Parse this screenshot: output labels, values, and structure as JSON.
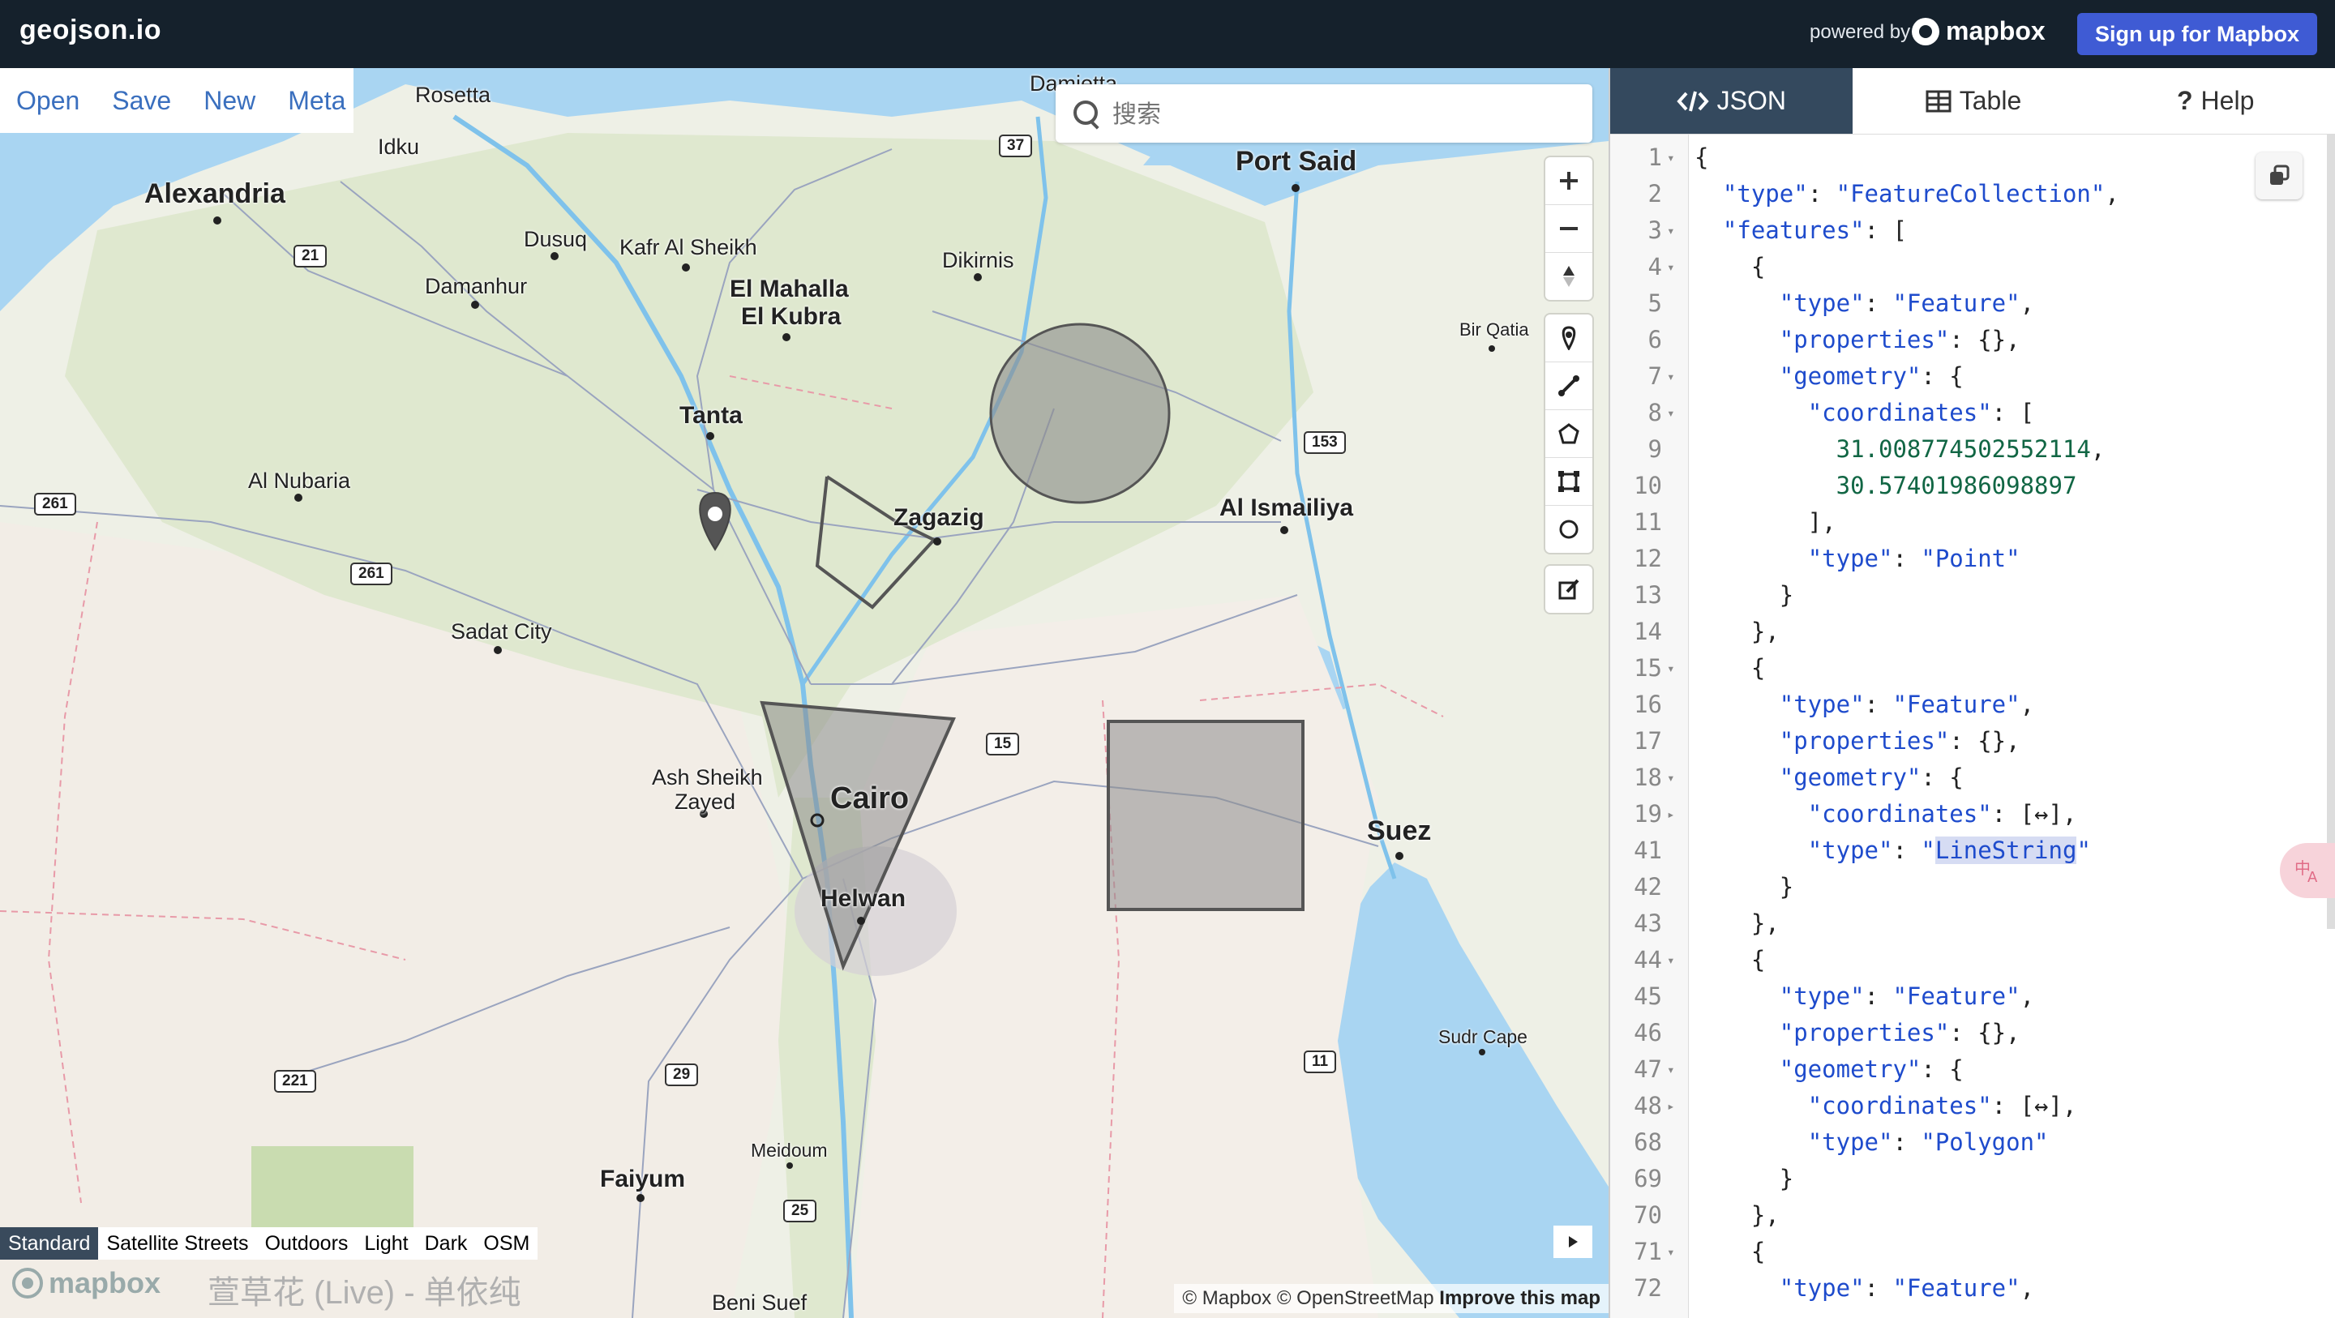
{
  "header": {
    "brand": "geojson.io",
    "powered_by": "powered by",
    "mapbox_logo": "mapbox",
    "signup_label": "Sign up for Mapbox"
  },
  "menu": {
    "items": [
      "Open",
      "Save",
      "New",
      "Meta"
    ]
  },
  "search": {
    "placeholder": "搜索",
    "value": ""
  },
  "map_labels": {
    "cities": [
      "Alexandria",
      "Port Said",
      "Tanta",
      "Zagazig",
      "Cairo",
      "Helwan",
      "Suez",
      "Al Ismailiya",
      "El Mahalla",
      "El Kubra",
      "Faiyum"
    ],
    "towns": [
      "Rosetta",
      "Idku",
      "Dusuq",
      "Kafr Al Sheikh",
      "Damanhur",
      "Dikirnis",
      "Damietta",
      "Bir Qatia",
      "Al Nubaria",
      "Sadat City",
      "Ash Sheikh",
      "Zayed",
      "Meidoum",
      "Beni Suef",
      "Sudr Cape"
    ],
    "road_shields": [
      "37",
      "21",
      "153",
      "261",
      "261",
      "15",
      "29",
      "221",
      "25",
      "11"
    ]
  },
  "map_styles": {
    "items": [
      "Standard",
      "Satellite Streets",
      "Outdoors",
      "Light",
      "Dark",
      "OSM"
    ],
    "active": "Standard"
  },
  "map_footer": {
    "logo": "mapbox",
    "overlay_text": "萱草花 (Live) - 单依纯",
    "attribution": "© Mapbox © OpenStreetMap",
    "improve": "Improve this map"
  },
  "icons": {
    "zoom_in": "plus-icon",
    "zoom_out": "minus-icon",
    "compass": "compass-icon",
    "draw_point": "marker-icon",
    "draw_line": "line-icon",
    "draw_polygon": "polygon-icon",
    "draw_rectangle": "rectangle-icon",
    "draw_circle": "circle-icon",
    "edit": "edit-icon",
    "copy": "copy-icon",
    "search": "search-icon",
    "translate": "translate-icon"
  },
  "tabs": [
    {
      "label": "JSON",
      "active": true
    },
    {
      "label": "Table",
      "active": false
    },
    {
      "label": "Help",
      "active": false
    }
  ],
  "code_lines": [
    {
      "n": "1",
      "fold": "▾",
      "text": "{"
    },
    {
      "n": "2",
      "fold": "",
      "text": "  \"type\": \"FeatureCollection\","
    },
    {
      "n": "3",
      "fold": "▾",
      "text": "  \"features\": ["
    },
    {
      "n": "4",
      "fold": "▾",
      "text": "    {"
    },
    {
      "n": "5",
      "fold": "",
      "text": "      \"type\": \"Feature\","
    },
    {
      "n": "6",
      "fold": "",
      "text": "      \"properties\": {},"
    },
    {
      "n": "7",
      "fold": "▾",
      "text": "      \"geometry\": {"
    },
    {
      "n": "8",
      "fold": "▾",
      "text": "        \"coordinates\": ["
    },
    {
      "n": "9",
      "fold": "",
      "text": "          31.008774502552114,"
    },
    {
      "n": "10",
      "fold": "",
      "text": "          30.57401986098897"
    },
    {
      "n": "11",
      "fold": "",
      "text": "        ],"
    },
    {
      "n": "12",
      "fold": "",
      "text": "        \"type\": \"Point\""
    },
    {
      "n": "13",
      "fold": "",
      "text": "      }"
    },
    {
      "n": "14",
      "fold": "",
      "text": "    },"
    },
    {
      "n": "15",
      "fold": "▾",
      "text": "    {"
    },
    {
      "n": "16",
      "fold": "",
      "text": "      \"type\": \"Feature\","
    },
    {
      "n": "17",
      "fold": "",
      "text": "      \"properties\": {},"
    },
    {
      "n": "18",
      "fold": "▾",
      "text": "      \"geometry\": {"
    },
    {
      "n": "19",
      "fold": "▸",
      "text": "        \"coordinates\": [↔],"
    },
    {
      "n": "41",
      "fold": "",
      "text": "        \"type\": \"LineString\""
    },
    {
      "n": "42",
      "fold": "",
      "text": "      }"
    },
    {
      "n": "43",
      "fold": "",
      "text": "    },"
    },
    {
      "n": "44",
      "fold": "▾",
      "text": "    {"
    },
    {
      "n": "45",
      "fold": "",
      "text": "      \"type\": \"Feature\","
    },
    {
      "n": "46",
      "fold": "",
      "text": "      \"properties\": {},"
    },
    {
      "n": "47",
      "fold": "▾",
      "text": "      \"geometry\": {"
    },
    {
      "n": "48",
      "fold": "▸",
      "text": "        \"coordinates\": [↔],"
    },
    {
      "n": "68",
      "fold": "",
      "text": "        \"type\": \"Polygon\""
    },
    {
      "n": "69",
      "fold": "",
      "text": "      }"
    },
    {
      "n": "70",
      "fold": "",
      "text": "    },"
    },
    {
      "n": "71",
      "fold": "▾",
      "text": "    {"
    },
    {
      "n": "72",
      "fold": "",
      "text": "      \"type\": \"Feature\","
    }
  ],
  "highlighted_word": "LineString",
  "colors": {
    "header_bg": "#15212c",
    "signup": "#3f5bd4",
    "tab_active": "#34495e",
    "feature_fill": "#8c8c8c",
    "feature_stroke": "#555555"
  }
}
